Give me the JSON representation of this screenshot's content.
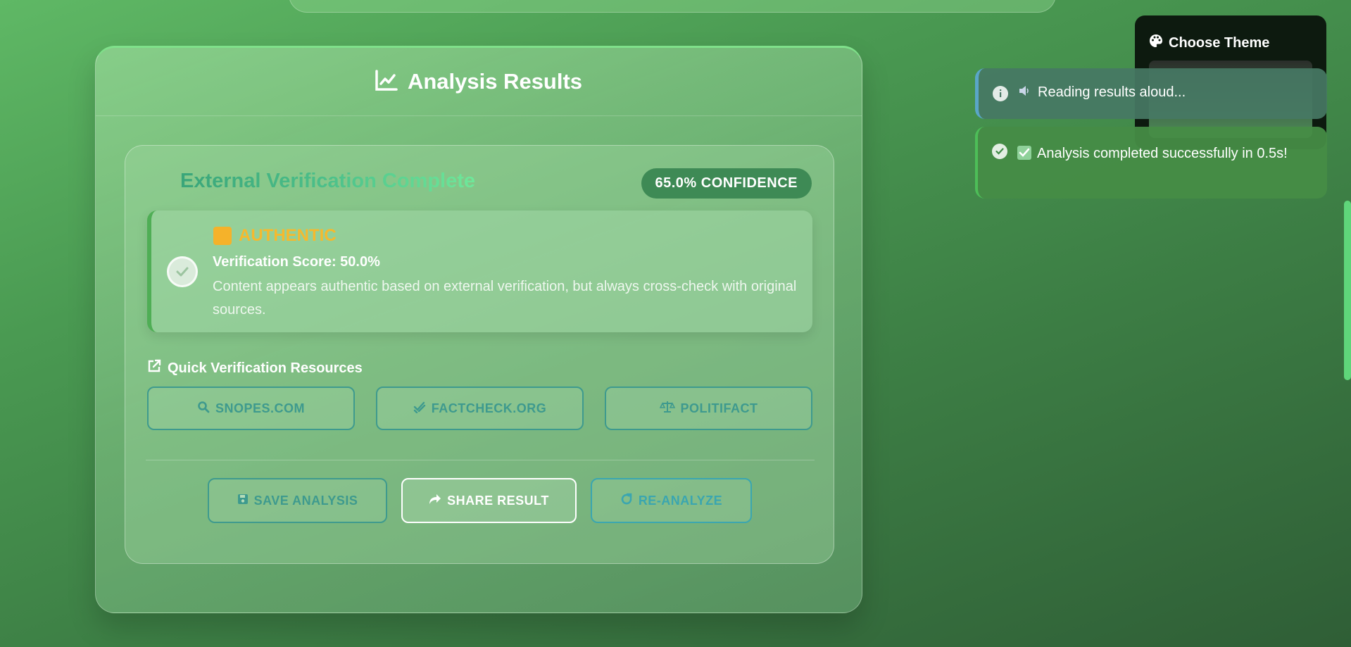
{
  "header": {
    "title": "Analysis Results"
  },
  "verification": {
    "title": "External Verification Complete",
    "confidence": "65.0% CONFIDENCE",
    "verdict": "AUTHENTIC",
    "score": "Verification Score: 50.0%",
    "description": "Content appears authentic based on external verification, but always cross-check with original sources."
  },
  "resources": {
    "title": "Quick Verification Resources",
    "buttons": [
      "SNOPES.COM",
      "FACTCHECK.ORG",
      "POLITIFACT"
    ]
  },
  "actions": {
    "save": "SAVE ANALYSIS",
    "share": "SHARE RESULT",
    "reanalyze": "RE-ANALYZE"
  },
  "theme_panel": {
    "title": "Choose Theme"
  },
  "toasts": {
    "info": "Reading results aloud...",
    "success": "Analysis completed successfully in 0.5s!"
  },
  "colors": {
    "accent_green": "#4fae55",
    "verdict_gold": "#f5b92e",
    "teal": "#3e9a8e"
  }
}
